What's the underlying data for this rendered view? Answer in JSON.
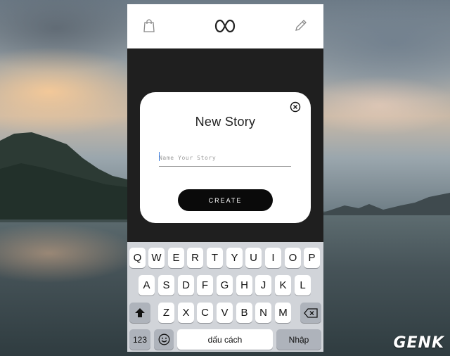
{
  "modal": {
    "title": "New Story",
    "input_placeholder": "Name Your Story",
    "input_value": "",
    "create_label": "CREATE"
  },
  "navbar": {
    "left_icon": "shopping-bag-icon",
    "center_icon": "app-logo-icon",
    "right_icon": "pencil-icon"
  },
  "keyboard": {
    "row1": [
      "Q",
      "W",
      "E",
      "R",
      "T",
      "Y",
      "U",
      "I",
      "O",
      "P"
    ],
    "row2": [
      "A",
      "S",
      "D",
      "F",
      "G",
      "H",
      "J",
      "K",
      "L"
    ],
    "row3": [
      "Z",
      "X",
      "C",
      "V",
      "B",
      "N",
      "M"
    ],
    "numbers_label": "123",
    "space_label": "dấu cách",
    "return_label": "Nhập",
    "shift_icon": "shift-icon",
    "backspace_icon": "backspace-icon",
    "emoji_icon": "emoji-icon"
  },
  "watermark": "GENK"
}
